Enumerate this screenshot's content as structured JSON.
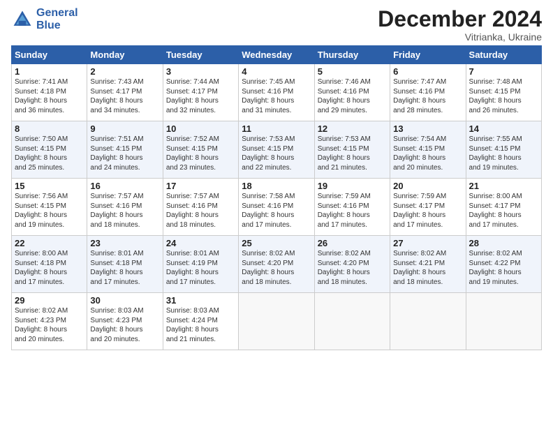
{
  "header": {
    "logo_line1": "General",
    "logo_line2": "Blue",
    "month_title": "December 2024",
    "subtitle": "Vitrianka, Ukraine"
  },
  "weekdays": [
    "Sunday",
    "Monday",
    "Tuesday",
    "Wednesday",
    "Thursday",
    "Friday",
    "Saturday"
  ],
  "weeks": [
    [
      {
        "day": "1",
        "lines": [
          "Sunrise: 7:41 AM",
          "Sunset: 4:18 PM",
          "Daylight: 8 hours",
          "and 36 minutes."
        ]
      },
      {
        "day": "2",
        "lines": [
          "Sunrise: 7:43 AM",
          "Sunset: 4:17 PM",
          "Daylight: 8 hours",
          "and 34 minutes."
        ]
      },
      {
        "day": "3",
        "lines": [
          "Sunrise: 7:44 AM",
          "Sunset: 4:17 PM",
          "Daylight: 8 hours",
          "and 32 minutes."
        ]
      },
      {
        "day": "4",
        "lines": [
          "Sunrise: 7:45 AM",
          "Sunset: 4:16 PM",
          "Daylight: 8 hours",
          "and 31 minutes."
        ]
      },
      {
        "day": "5",
        "lines": [
          "Sunrise: 7:46 AM",
          "Sunset: 4:16 PM",
          "Daylight: 8 hours",
          "and 29 minutes."
        ]
      },
      {
        "day": "6",
        "lines": [
          "Sunrise: 7:47 AM",
          "Sunset: 4:16 PM",
          "Daylight: 8 hours",
          "and 28 minutes."
        ]
      },
      {
        "day": "7",
        "lines": [
          "Sunrise: 7:48 AM",
          "Sunset: 4:15 PM",
          "Daylight: 8 hours",
          "and 26 minutes."
        ]
      }
    ],
    [
      {
        "day": "8",
        "lines": [
          "Sunrise: 7:50 AM",
          "Sunset: 4:15 PM",
          "Daylight: 8 hours",
          "and 25 minutes."
        ]
      },
      {
        "day": "9",
        "lines": [
          "Sunrise: 7:51 AM",
          "Sunset: 4:15 PM",
          "Daylight: 8 hours",
          "and 24 minutes."
        ]
      },
      {
        "day": "10",
        "lines": [
          "Sunrise: 7:52 AM",
          "Sunset: 4:15 PM",
          "Daylight: 8 hours",
          "and 23 minutes."
        ]
      },
      {
        "day": "11",
        "lines": [
          "Sunrise: 7:53 AM",
          "Sunset: 4:15 PM",
          "Daylight: 8 hours",
          "and 22 minutes."
        ]
      },
      {
        "day": "12",
        "lines": [
          "Sunrise: 7:53 AM",
          "Sunset: 4:15 PM",
          "Daylight: 8 hours",
          "and 21 minutes."
        ]
      },
      {
        "day": "13",
        "lines": [
          "Sunrise: 7:54 AM",
          "Sunset: 4:15 PM",
          "Daylight: 8 hours",
          "and 20 minutes."
        ]
      },
      {
        "day": "14",
        "lines": [
          "Sunrise: 7:55 AM",
          "Sunset: 4:15 PM",
          "Daylight: 8 hours",
          "and 19 minutes."
        ]
      }
    ],
    [
      {
        "day": "15",
        "lines": [
          "Sunrise: 7:56 AM",
          "Sunset: 4:15 PM",
          "Daylight: 8 hours",
          "and 19 minutes."
        ]
      },
      {
        "day": "16",
        "lines": [
          "Sunrise: 7:57 AM",
          "Sunset: 4:16 PM",
          "Daylight: 8 hours",
          "and 18 minutes."
        ]
      },
      {
        "day": "17",
        "lines": [
          "Sunrise: 7:57 AM",
          "Sunset: 4:16 PM",
          "Daylight: 8 hours",
          "and 18 minutes."
        ]
      },
      {
        "day": "18",
        "lines": [
          "Sunrise: 7:58 AM",
          "Sunset: 4:16 PM",
          "Daylight: 8 hours",
          "and 17 minutes."
        ]
      },
      {
        "day": "19",
        "lines": [
          "Sunrise: 7:59 AM",
          "Sunset: 4:16 PM",
          "Daylight: 8 hours",
          "and 17 minutes."
        ]
      },
      {
        "day": "20",
        "lines": [
          "Sunrise: 7:59 AM",
          "Sunset: 4:17 PM",
          "Daylight: 8 hours",
          "and 17 minutes."
        ]
      },
      {
        "day": "21",
        "lines": [
          "Sunrise: 8:00 AM",
          "Sunset: 4:17 PM",
          "Daylight: 8 hours",
          "and 17 minutes."
        ]
      }
    ],
    [
      {
        "day": "22",
        "lines": [
          "Sunrise: 8:00 AM",
          "Sunset: 4:18 PM",
          "Daylight: 8 hours",
          "and 17 minutes."
        ]
      },
      {
        "day": "23",
        "lines": [
          "Sunrise: 8:01 AM",
          "Sunset: 4:18 PM",
          "Daylight: 8 hours",
          "and 17 minutes."
        ]
      },
      {
        "day": "24",
        "lines": [
          "Sunrise: 8:01 AM",
          "Sunset: 4:19 PM",
          "Daylight: 8 hours",
          "and 17 minutes."
        ]
      },
      {
        "day": "25",
        "lines": [
          "Sunrise: 8:02 AM",
          "Sunset: 4:20 PM",
          "Daylight: 8 hours",
          "and 18 minutes."
        ]
      },
      {
        "day": "26",
        "lines": [
          "Sunrise: 8:02 AM",
          "Sunset: 4:20 PM",
          "Daylight: 8 hours",
          "and 18 minutes."
        ]
      },
      {
        "day": "27",
        "lines": [
          "Sunrise: 8:02 AM",
          "Sunset: 4:21 PM",
          "Daylight: 8 hours",
          "and 18 minutes."
        ]
      },
      {
        "day": "28",
        "lines": [
          "Sunrise: 8:02 AM",
          "Sunset: 4:22 PM",
          "Daylight: 8 hours",
          "and 19 minutes."
        ]
      }
    ],
    [
      {
        "day": "29",
        "lines": [
          "Sunrise: 8:02 AM",
          "Sunset: 4:23 PM",
          "Daylight: 8 hours",
          "and 20 minutes."
        ]
      },
      {
        "day": "30",
        "lines": [
          "Sunrise: 8:03 AM",
          "Sunset: 4:23 PM",
          "Daylight: 8 hours",
          "and 20 minutes."
        ]
      },
      {
        "day": "31",
        "lines": [
          "Sunrise: 8:03 AM",
          "Sunset: 4:24 PM",
          "Daylight: 8 hours",
          "and 21 minutes."
        ]
      },
      null,
      null,
      null,
      null
    ]
  ]
}
